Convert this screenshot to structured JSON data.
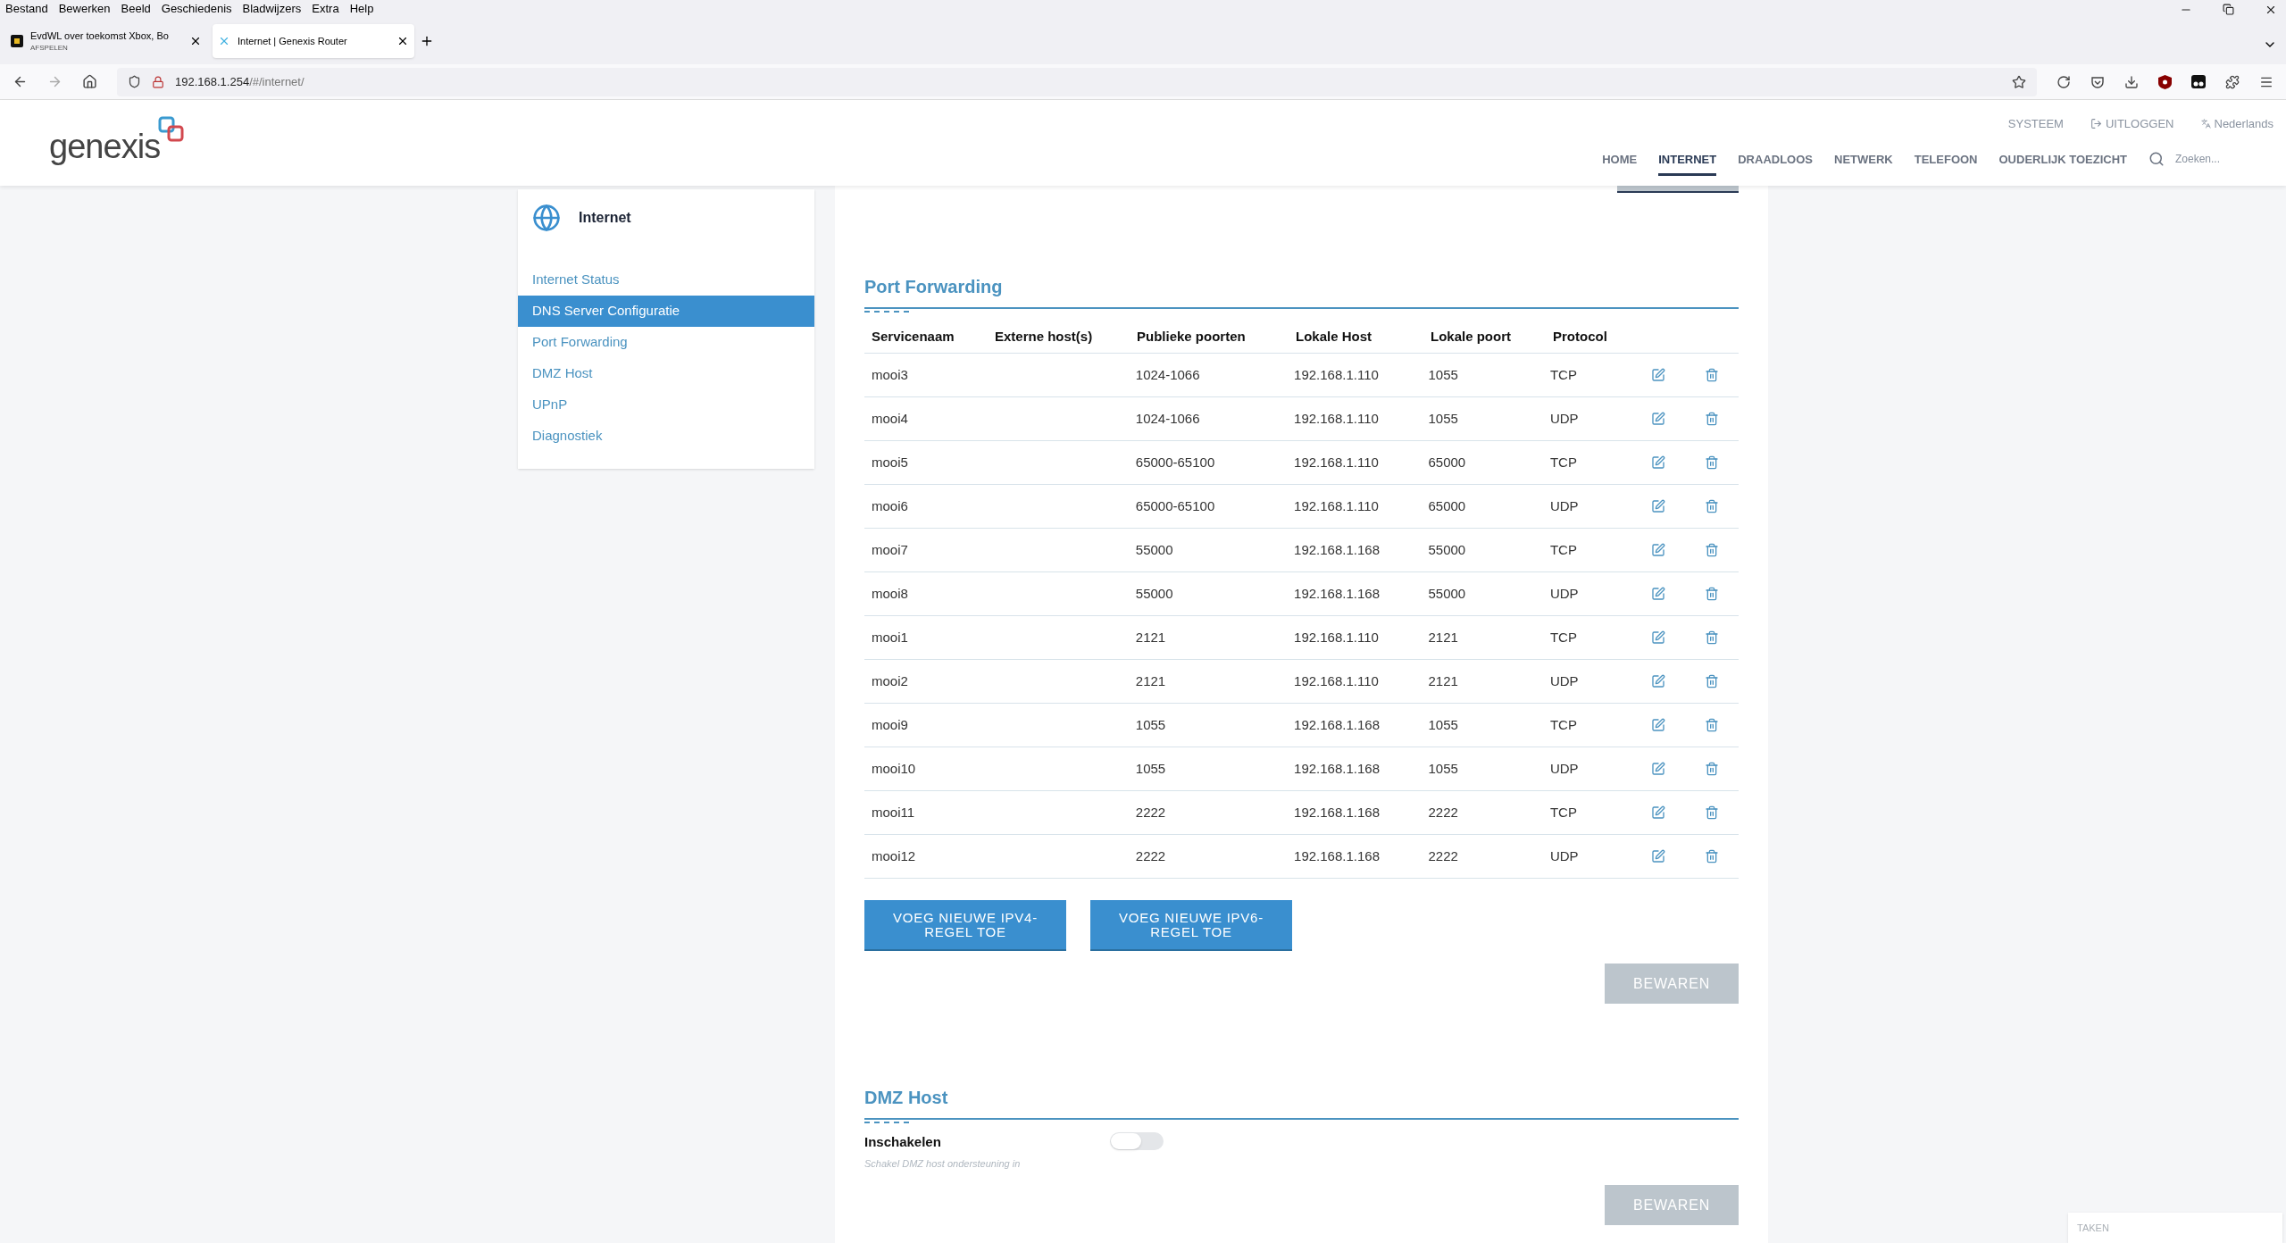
{
  "menu_bar": [
    "Bestand",
    "Bewerken",
    "Beeld",
    "Geschiedenis",
    "Bladwijzers",
    "Extra",
    "Help"
  ],
  "browser_tabs": [
    {
      "title": "EvdWL over toekomst Xbox, Bo",
      "subtitle": "AFSPELEN",
      "selected": false
    },
    {
      "title": "Internet | Genexis Router",
      "selected": true
    }
  ],
  "address_bar": {
    "host": "192.168.1.254",
    "path": "/#/internet/"
  },
  "header": {
    "logo": "genexis",
    "top_links": [
      {
        "label": "SYSTEEM",
        "kind": "plain"
      },
      {
        "label": "UITLOGGEN",
        "kind": "logout"
      },
      {
        "label": "Nederlands",
        "kind": "language"
      }
    ],
    "nav": [
      {
        "label": "HOME",
        "selected": false
      },
      {
        "label": "INTERNET",
        "selected": true
      },
      {
        "label": "DRAADLOOS",
        "selected": false
      },
      {
        "label": "NETWERK",
        "selected": false
      },
      {
        "label": "TELEFOON",
        "selected": false
      },
      {
        "label": "OUDERLIJK TOEZICHT",
        "selected": false
      }
    ],
    "search": {
      "placeholder": "Zoeken..."
    }
  },
  "sidebar": {
    "title": "Internet",
    "items": [
      {
        "label": "Internet Status",
        "selected": false
      },
      {
        "label": "DNS Server Configuratie",
        "selected": true
      },
      {
        "label": "Port Forwarding",
        "selected": false
      },
      {
        "label": "DMZ Host",
        "selected": false
      },
      {
        "label": "UPnP",
        "selected": false
      },
      {
        "label": "Diagnostiek",
        "selected": false
      }
    ]
  },
  "port_forwarding": {
    "title": "Port Forwarding",
    "columns": [
      "Servicenaam",
      "Externe host(s)",
      "Publieke poorten",
      "Lokale Host",
      "Lokale poort",
      "Protocol"
    ],
    "rows": [
      [
        "mooi3",
        "",
        "1024-1066",
        "192.168.1.110",
        "1055",
        "TCP"
      ],
      [
        "mooi4",
        "",
        "1024-1066",
        "192.168.1.110",
        "1055",
        "UDP"
      ],
      [
        "mooi5",
        "",
        "65000-65100",
        "192.168.1.110",
        "65000",
        "TCP"
      ],
      [
        "mooi6",
        "",
        "65000-65100",
        "192.168.1.110",
        "65000",
        "UDP"
      ],
      [
        "mooi7",
        "",
        "55000",
        "192.168.1.168",
        "55000",
        "TCP"
      ],
      [
        "mooi8",
        "",
        "55000",
        "192.168.1.168",
        "55000",
        "UDP"
      ],
      [
        "mooi1",
        "",
        "2121",
        "192.168.1.110",
        "2121",
        "TCP"
      ],
      [
        "mooi2",
        "",
        "2121",
        "192.168.1.110",
        "2121",
        "UDP"
      ],
      [
        "mooi9",
        "",
        "1055",
        "192.168.1.168",
        "1055",
        "TCP"
      ],
      [
        "mooi10",
        "",
        "1055",
        "192.168.1.168",
        "1055",
        "UDP"
      ],
      [
        "mooi11",
        "",
        "2222",
        "192.168.1.168",
        "2222",
        "TCP"
      ],
      [
        "mooi12",
        "",
        "2222",
        "192.168.1.168",
        "2222",
        "UDP"
      ]
    ],
    "add_buttons": [
      "VOEG NIEUWE IPV4-REGEL TOE",
      "VOEG NIEUWE IPV6-REGEL TOE"
    ],
    "save_button": {
      "label": "BEWAREN",
      "disabled": true
    }
  },
  "dmz_host": {
    "title": "DMZ Host",
    "toggle": {
      "label": "Inschakelen",
      "hint": "Schakel DMZ host ondersteuning in",
      "on": false
    },
    "save_button": {
      "label": "BEWAREN",
      "disabled": true
    }
  },
  "tasks_field": {
    "placeholder": "TAKEN"
  }
}
